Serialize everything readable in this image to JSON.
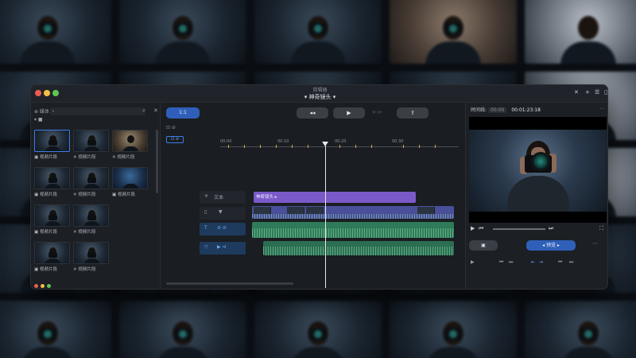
{
  "window": {
    "app_name": "剪辑器",
    "project_name": "▾ 神奇镜头 ▾"
  },
  "sidebar": {
    "top_label": "⊕ 媒体",
    "folder_label": "▾ ■",
    "search_placeholder": "▸",
    "media": [
      {
        "label": "▣ 视频片段",
        "selected": true,
        "tone": "dark"
      },
      {
        "label": "✕ 视频片段",
        "selected": false,
        "tone": "dark"
      },
      {
        "label": "✕ 视频片段",
        "selected": false,
        "tone": "warm"
      },
      {
        "label": "▣ 视频片段",
        "selected": false,
        "tone": "dark"
      },
      {
        "label": "✕ 视频片段",
        "selected": false,
        "tone": "dark"
      },
      {
        "label": "▣ 视频片段",
        "selected": false,
        "tone": "blue"
      },
      {
        "label": "▣ 视频片段",
        "selected": false,
        "tone": "dark"
      },
      {
        "label": "✕ 视频片段",
        "selected": false,
        "tone": "dark"
      },
      {
        "label": "",
        "selected": false,
        "tone": "none"
      },
      {
        "label": "▣ 视频片段",
        "selected": false,
        "tone": "dark"
      },
      {
        "label": "✕ 视频片段",
        "selected": false,
        "tone": "dark"
      },
      {
        "label": "",
        "selected": false,
        "tone": "none"
      },
      {
        "label": "▣ 视频片段",
        "selected": false,
        "tone": "dark"
      },
      {
        "label": "✕ 视频片段",
        "selected": false,
        "tone": "dark"
      },
      {
        "label": "▣ 视频片段",
        "selected": false,
        "tone": "blue"
      }
    ]
  },
  "timeline": {
    "mode_label": "1:1",
    "tool_a": "⊡ ⊘",
    "tool_b": "⊡ ⊘",
    "back_label": "◂◂",
    "play_label": "▶",
    "export_label": "⇪",
    "snap_label": "⊢ ⊢",
    "ruler_labels": [
      "00:00",
      "00:10",
      "00:20",
      "00:30"
    ],
    "tracks": [
      {
        "icon": "✕",
        "label": "文本"
      },
      {
        "icon": "▯",
        "label": "▼"
      },
      {
        "icon": "T",
        "label": "⊘ ⊘"
      },
      {
        "icon": "▽",
        "label": "▶ ⊲"
      }
    ],
    "title_clip": "神奇镜头 ▸"
  },
  "viewer": {
    "toolbar": [
      "✕",
      "+",
      "☰",
      "◫",
      "✕"
    ],
    "meta_label": "时间线:",
    "duration": "00:00",
    "timecode": "00:01:23:18",
    "more": "⋯",
    "grey_button": "▣",
    "blue_button": "◂ 预览 ▸",
    "dots": "⋯"
  },
  "colors": {
    "accent_blue": "#2f5fb8",
    "title_clip": "#7a5ac8",
    "video_clip": "#4a4f9a",
    "audio_clip": "#2f7a58"
  }
}
